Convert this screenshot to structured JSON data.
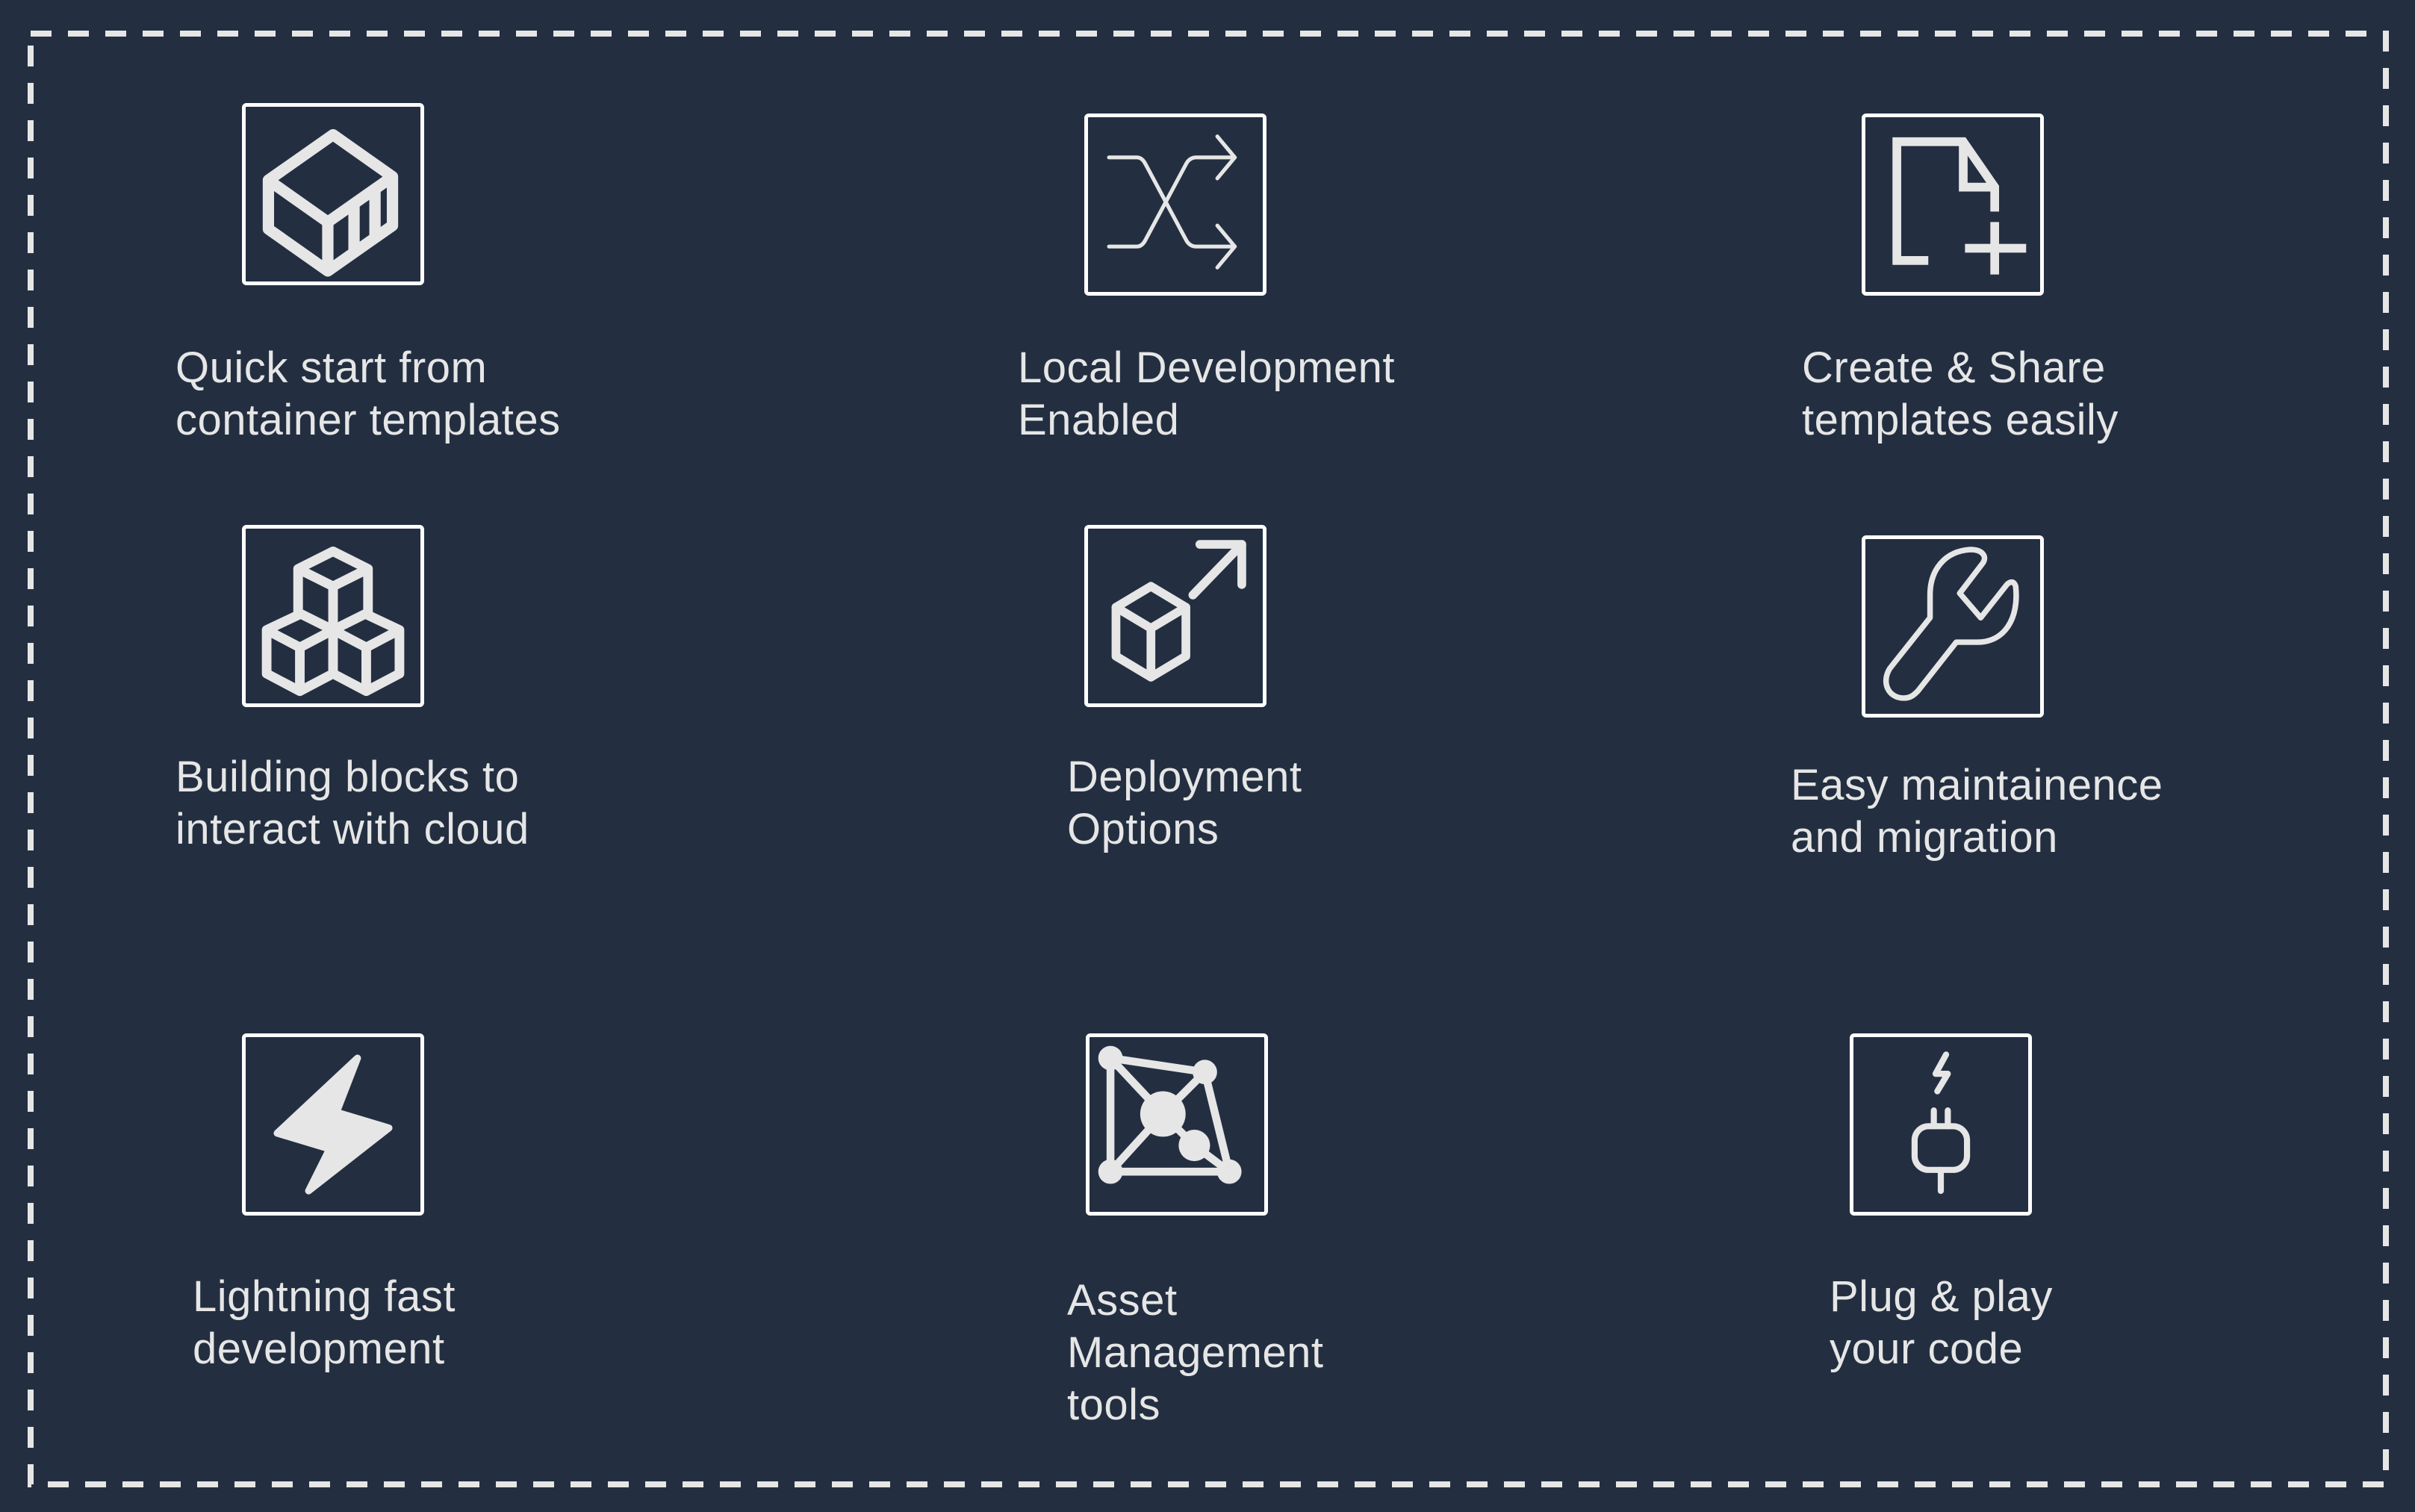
{
  "colors": {
    "background": "#232f41",
    "foreground": "#e6e6e6",
    "box_border": "#ffffff"
  },
  "features": [
    {
      "icon": "shipping-container-icon",
      "lines": [
        "Quick start from",
        "container templates"
      ]
    },
    {
      "icon": "shuffle-arrows-icon",
      "lines": [
        "Local Development",
        "Enabled"
      ]
    },
    {
      "icon": "new-file-plus-icon",
      "lines": [
        "Create & Share",
        "templates easily"
      ]
    },
    {
      "icon": "stacked-cubes-icon",
      "lines": [
        "Building blocks to",
        "interact with cloud"
      ]
    },
    {
      "icon": "cube-arrow-out-icon",
      "lines": [
        "Deployment",
        "Options"
      ]
    },
    {
      "icon": "wrench-icon",
      "lines": [
        "Easy maintainence",
        "and migration"
      ]
    },
    {
      "icon": "lightning-bolt-icon",
      "lines": [
        "Lightning fast",
        "development"
      ]
    },
    {
      "icon": "network-graph-icon",
      "lines": [
        "Asset",
        "Management",
        "tools"
      ]
    },
    {
      "icon": "plug-icon",
      "lines": [
        "Plug & play",
        "your code"
      ]
    }
  ]
}
